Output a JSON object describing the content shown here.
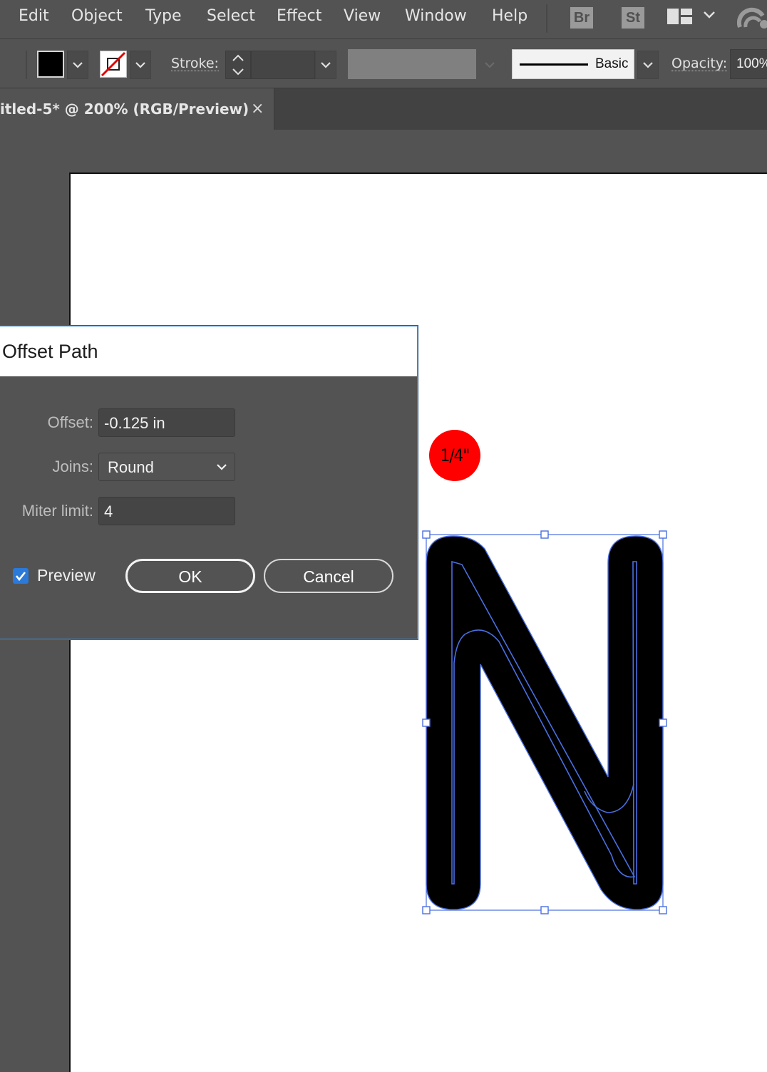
{
  "menubar": {
    "items": [
      "Edit",
      "Object",
      "Type",
      "Select",
      "Effect",
      "View",
      "Window",
      "Help"
    ],
    "apps": [
      "Br",
      "St"
    ]
  },
  "controlbar": {
    "stroke_label": "Stroke:",
    "brush_label": "Basic",
    "opacity_label": "Opacity:",
    "opacity_value": "100%"
  },
  "document": {
    "tab_title": "itled-5* @ 200% (RGB/Preview)",
    "close_glyph": "×"
  },
  "canvas": {
    "badge_text": "1/4\"",
    "badge_color": "#ff0000",
    "selection_color": "#4a6fe0"
  },
  "dialog": {
    "title": "Offset Path",
    "offset_label": "Offset:",
    "offset_value": "-0.125 in",
    "joins_label": "Joins:",
    "joins_value": "Round",
    "miter_label": "Miter limit:",
    "miter_value": "4",
    "preview_label": "Preview",
    "preview_checked": true,
    "ok_label": "OK",
    "cancel_label": "Cancel"
  }
}
